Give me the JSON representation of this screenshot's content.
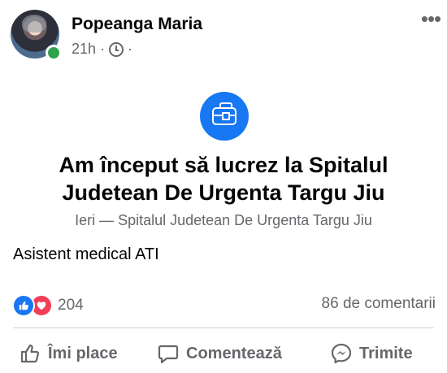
{
  "post": {
    "author": "Popeanga Maria",
    "time": "21h",
    "dot": "·",
    "headline_line1": "Am început să lucrez la Spitalul",
    "headline_line2": "Judetean De Urgenta Targu Jiu",
    "subline": "Ieri — Spitalul Judetean De Urgenta Targu Jiu",
    "body": "Asistent medical ATI",
    "more": "•••"
  },
  "stats": {
    "reactions_count": "204",
    "comments": "86 de comentarii"
  },
  "actions": {
    "like": "Îmi place",
    "comment": "Comentează",
    "share": "Trimite"
  },
  "colors": {
    "accent": "#1877f2",
    "love": "#f33e58",
    "online": "#31a24c",
    "secondary_text": "#65676b"
  },
  "icons": [
    "clock-icon",
    "more-icon",
    "briefcase-icon",
    "like-reaction-icon",
    "love-reaction-icon",
    "thumbs-up-icon",
    "comment-bubble-icon",
    "messenger-icon"
  ]
}
